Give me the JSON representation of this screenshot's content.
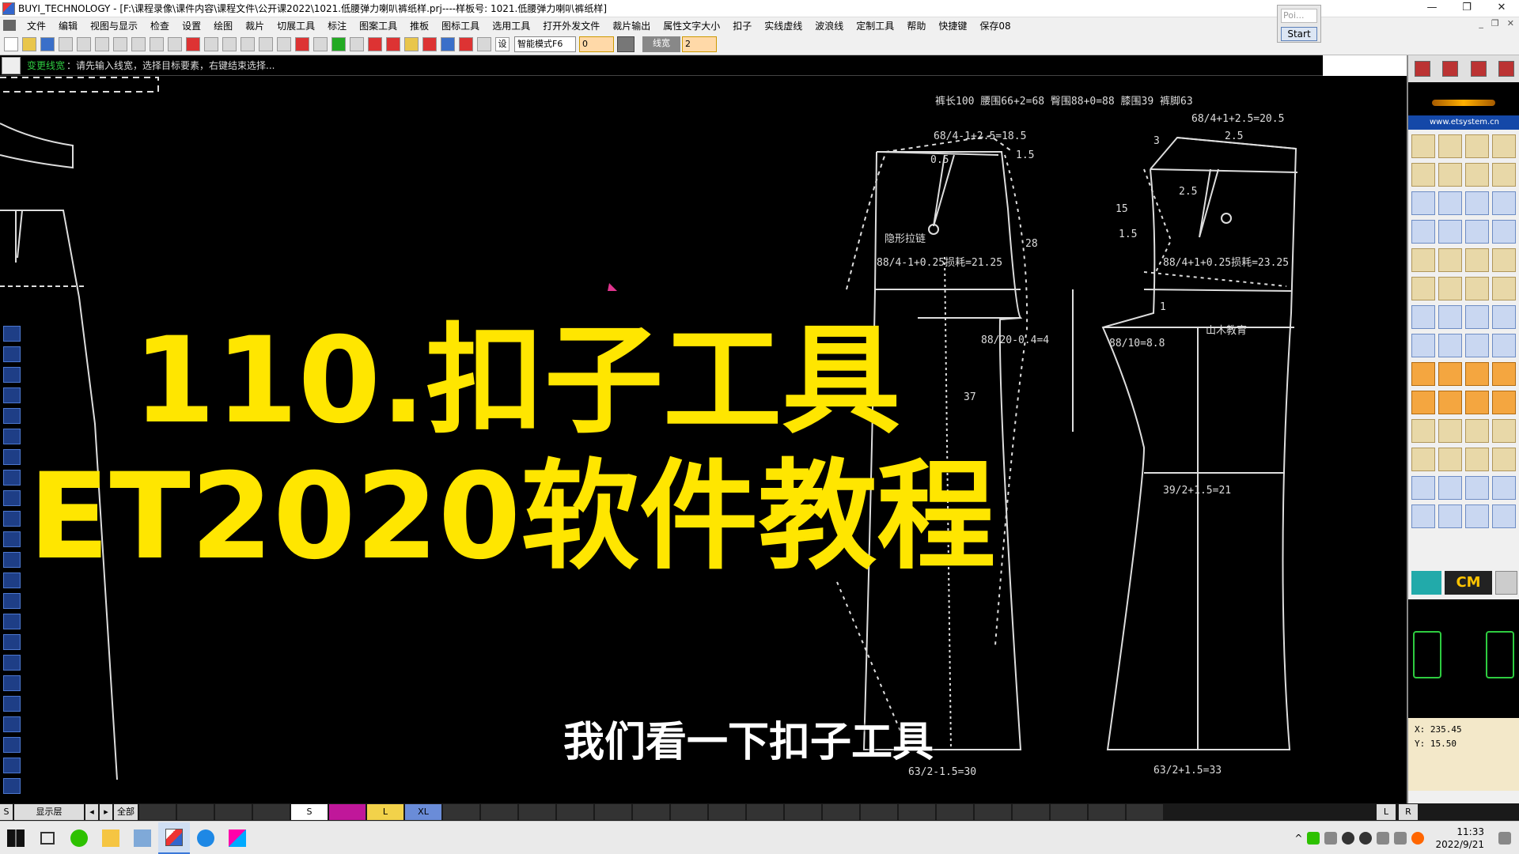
{
  "window": {
    "title": "BUYI_TECHNOLOGY - [F:\\课程录像\\课件内容\\课程文件\\公开课2022\\1021.低腰弹力喇叭裤纸样.prj----样板号: 1021.低腰弹力喇叭裤纸样]",
    "controls": [
      "—",
      "❐",
      "✕"
    ]
  },
  "menu": {
    "items": [
      "文件",
      "编辑",
      "视图与显示",
      "检查",
      "设置",
      "绘图",
      "裁片",
      "切展工具",
      "标注",
      "图案工具",
      "推板",
      "图标工具",
      "选用工具",
      "打开外发文件",
      "裁片输出",
      "属性文字大小",
      "扣子",
      "实线虚线",
      "波浪线",
      "定制工具",
      "帮助",
      "快捷键",
      "保存08"
    ],
    "mdi": [
      "_",
      "❐",
      "✕"
    ]
  },
  "floating": {
    "poi_label": "Poi...",
    "start_label": "Start"
  },
  "toolbar": {
    "settings_label": "设",
    "mode_select": "智能模式F6",
    "value_field": "0",
    "linewidth_label": "线宽",
    "linewidth_value": "2"
  },
  "prompt": {
    "mode": "变更线宽",
    "text": "：请先输入线宽，选择目标要素，右键结束选择..."
  },
  "drawing": {
    "header": "裤长100   腰围66+2=68   臀围88+0=88   膝围39   裤脚63",
    "front_labels": {
      "waist": "68/4-1+2.5=18.5",
      "offset": "1.5",
      "zipper": "隐形拉链",
      "hip": "88/4-1+0.25损耗=21.25",
      "side": "28",
      "crotch": "88/20-0.4=4",
      "knee_len": "37",
      "hem": "63/2-1.5=30",
      "small": "0.5"
    },
    "back_labels": {
      "waist": "68/4+1+2.5=20.5",
      "w1": "3",
      "w2": "2.5",
      "w3": "2.5",
      "side15": "15",
      "side1": "1.5",
      "hip": "88/4+1+0.25损耗=23.25",
      "crotch": "88/10=8.8",
      "brand": "山木教育",
      "knee": "39/2+1.5=21",
      "hem": "63/2+1.5=33",
      "one": "1"
    }
  },
  "overlay": {
    "line1": "110.扣子工具",
    "line2": "ET2020软件教程",
    "subtitle": "我们看一下扣子工具"
  },
  "right_panel": {
    "url": "www.etsystem.cn",
    "cm_label": "CM",
    "coord_x": "X:  235.45",
    "coord_y": "Y:  15.50"
  },
  "sizebar": {
    "s_label": "S",
    "layer_label": "显示层",
    "prev": "◂",
    "next": "▸",
    "all_label": "全部",
    "sizes": [
      "",
      "",
      "",
      "",
      "S",
      "",
      "L",
      "XL",
      "",
      "",
      "",
      "",
      "",
      "",
      "",
      "",
      "",
      "",
      "",
      "",
      "",
      "",
      "",
      "",
      "",
      "",
      "",
      "",
      "",
      "",
      ""
    ],
    "left_label": "L",
    "right_label": "R"
  },
  "taskbar": {
    "time": "11:33",
    "date": "2022/9/21"
  },
  "colors": {
    "title_yellow": "#ffe600",
    "prompt_green": "#2ecc40",
    "canvas_bg": "#000000"
  }
}
